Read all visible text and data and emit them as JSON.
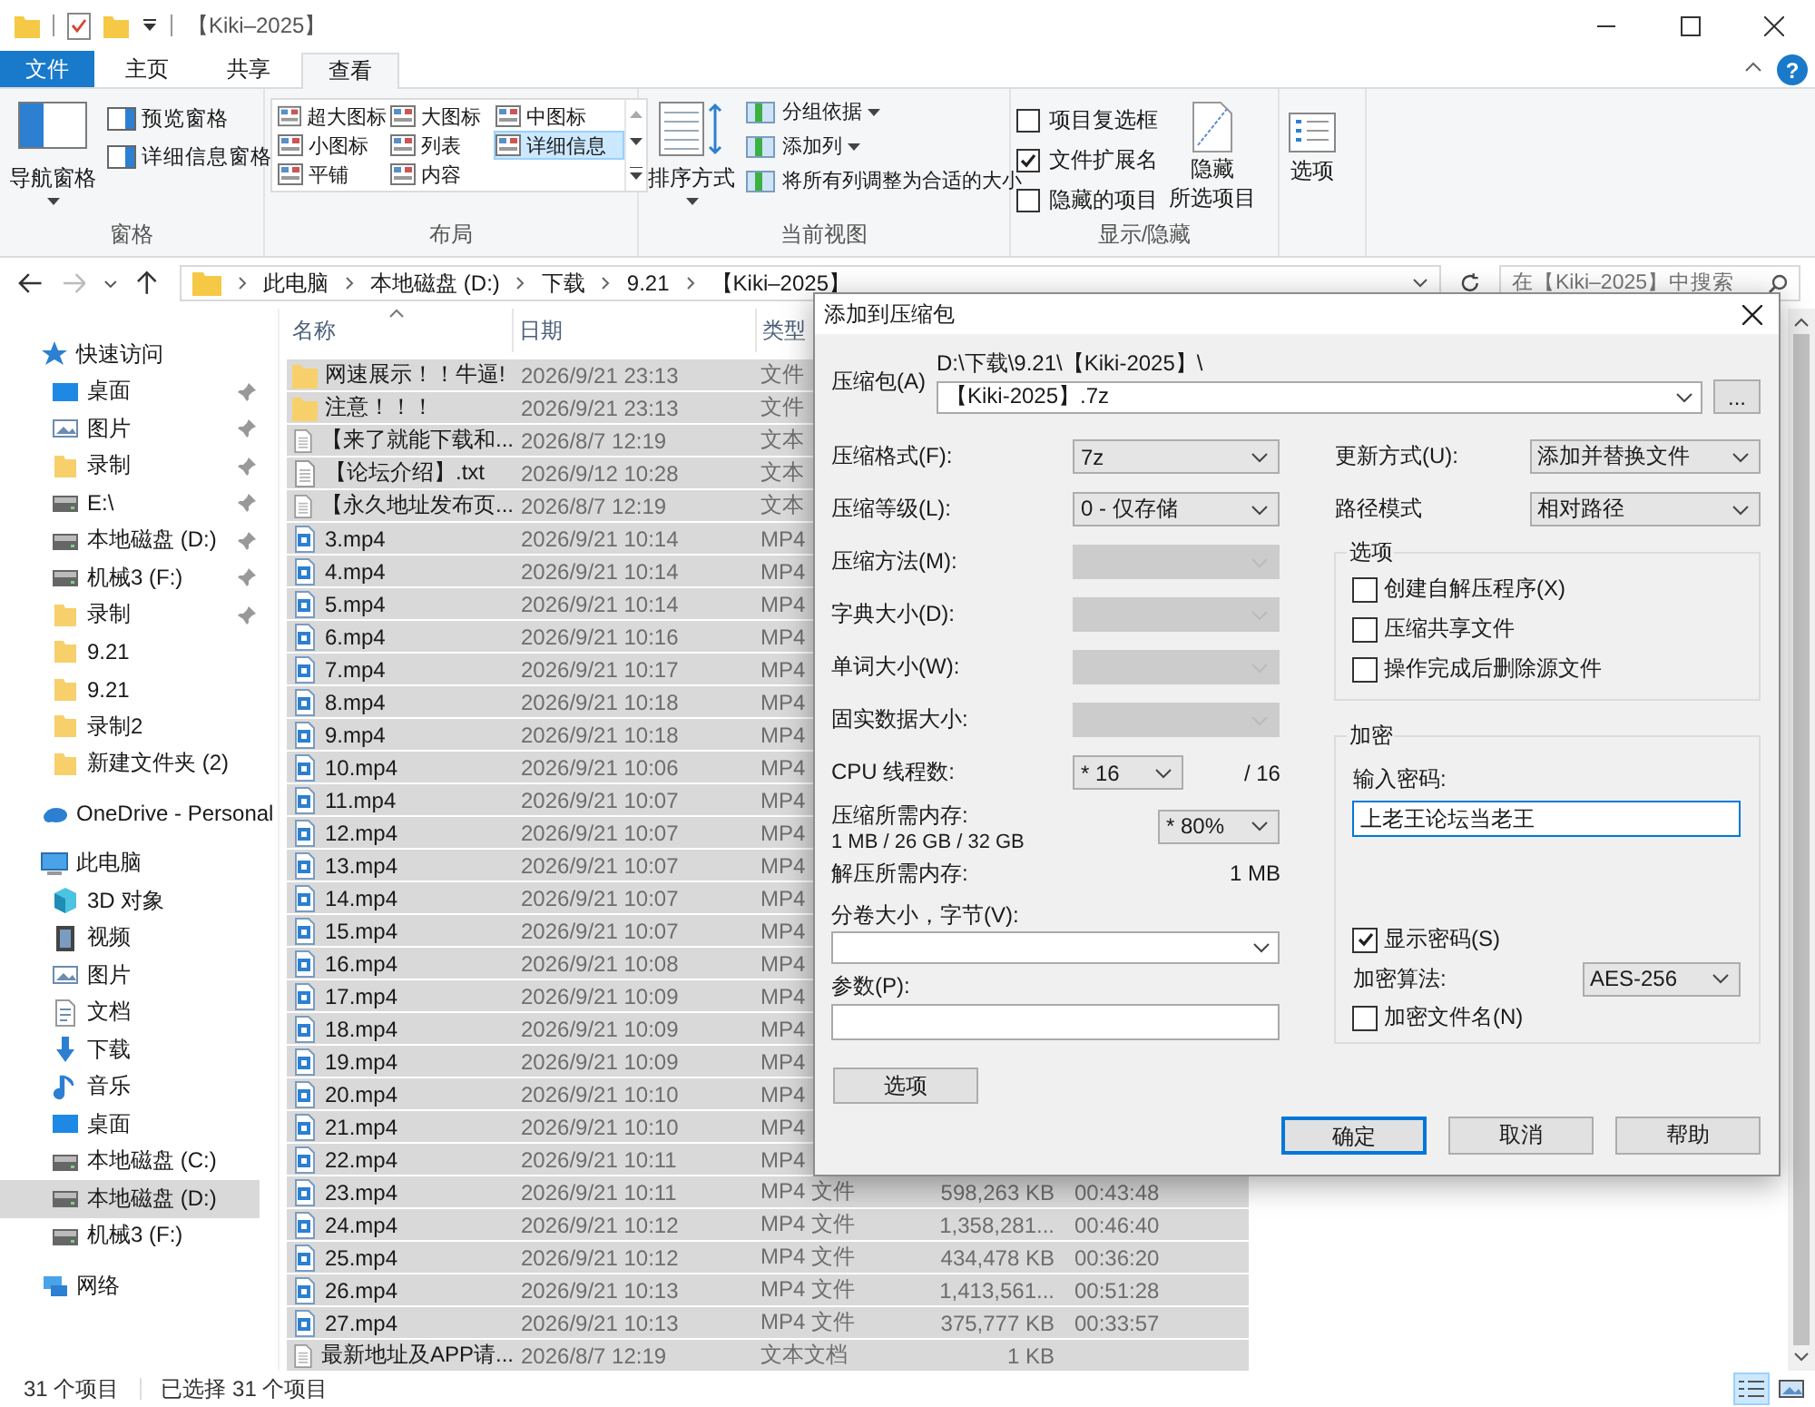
{
  "window": {
    "title": "【Kiki–2025】"
  },
  "ribbon_tabs": [
    {
      "label": "文件",
      "kind": "file",
      "selected": false
    },
    {
      "label": "主页",
      "kind": "tab",
      "selected": false
    },
    {
      "label": "共享",
      "kind": "tab",
      "selected": false
    },
    {
      "label": "查看",
      "kind": "tab",
      "selected": true
    }
  ],
  "help": "?",
  "ribbon": {
    "panes": {
      "title": "窗格",
      "nav": "导航窗格",
      "items": [
        "预览窗格",
        "详细信息窗格"
      ]
    },
    "layout": {
      "title": "布局",
      "items": [
        {
          "label": "超大图标",
          "selected": false
        },
        {
          "label": "大图标",
          "selected": false
        },
        {
          "label": "中图标",
          "selected": false
        },
        {
          "label": "小图标",
          "selected": false
        },
        {
          "label": "列表",
          "selected": false
        },
        {
          "label": "详细信息",
          "selected": true
        },
        {
          "label": "平铺",
          "selected": false
        },
        {
          "label": "内容",
          "selected": false
        }
      ]
    },
    "current_view": {
      "title": "当前视图",
      "sort": "排序方式",
      "items": [
        {
          "label": "分组依据",
          "dropdown": true
        },
        {
          "label": "添加列",
          "dropdown": true
        },
        {
          "label": "将所有列调整为合适的大小",
          "dropdown": false
        }
      ]
    },
    "show_hide": {
      "title": "显示/隐藏",
      "checks": [
        {
          "label": "项目复选框",
          "checked": false
        },
        {
          "label": "文件扩展名",
          "checked": true
        },
        {
          "label": "隐藏的项目",
          "checked": false
        }
      ],
      "hide_selected": [
        "隐藏",
        "所选项目"
      ]
    },
    "options": "选项"
  },
  "address": {
    "crumbs": [
      "此电脑",
      "本地磁盘 (D:)",
      "下载",
      "9.21",
      "【Kiki–2025】"
    ],
    "search_placeholder": "在【Kiki–2025】中搜索"
  },
  "sidebar": [
    {
      "label": "快速访问",
      "kind": "star",
      "selected": false,
      "children": [
        {
          "label": "桌面",
          "kind": "desktop",
          "pinned": true,
          "selected": false
        },
        {
          "label": "图片",
          "kind": "pictures",
          "pinned": true,
          "selected": false
        },
        {
          "label": "录制",
          "kind": "folder",
          "pinned": true,
          "selected": false
        },
        {
          "label": "E:\\",
          "kind": "drive",
          "pinned": true,
          "selected": false
        },
        {
          "label": "本地磁盘 (D:)",
          "kind": "drive",
          "pinned": true,
          "selected": false
        },
        {
          "label": "机械3 (F:)",
          "kind": "drive",
          "pinned": true,
          "selected": false
        },
        {
          "label": "录制",
          "kind": "folder",
          "pinned": true,
          "selected": false
        },
        {
          "label": "9.21",
          "kind": "folder",
          "pinned": false,
          "selected": false
        },
        {
          "label": "9.21",
          "kind": "folder",
          "pinned": false,
          "selected": false
        },
        {
          "label": "录制2",
          "kind": "folder",
          "pinned": false,
          "selected": false
        },
        {
          "label": "新建文件夹 (2)",
          "kind": "folder",
          "pinned": false,
          "selected": false
        }
      ]
    },
    {
      "label": "OneDrive - Personal",
      "kind": "cloud",
      "selected": false
    },
    {
      "label": "此电脑",
      "kind": "pc",
      "selected": false,
      "children": [
        {
          "label": "3D 对象",
          "kind": "cube",
          "pinned": false,
          "selected": false
        },
        {
          "label": "视频",
          "kind": "video",
          "pinned": false,
          "selected": false
        },
        {
          "label": "图片",
          "kind": "pictures",
          "pinned": false,
          "selected": false
        },
        {
          "label": "文档",
          "kind": "document",
          "pinned": false,
          "selected": false
        },
        {
          "label": "下载",
          "kind": "download",
          "pinned": false,
          "selected": false
        },
        {
          "label": "音乐",
          "kind": "music",
          "pinned": false,
          "selected": false
        },
        {
          "label": "桌面",
          "kind": "desktop",
          "pinned": false,
          "selected": false
        },
        {
          "label": "本地磁盘 (C:)",
          "kind": "drive",
          "pinned": false,
          "selected": false
        },
        {
          "label": "本地磁盘 (D:)",
          "kind": "drive",
          "pinned": false,
          "selected": true
        },
        {
          "label": "机械3 (F:)",
          "kind": "drive",
          "pinned": false,
          "selected": false
        }
      ]
    },
    {
      "label": "网络",
      "kind": "network",
      "selected": false
    }
  ],
  "file_list": {
    "columns": [
      "名称",
      "日期",
      "类型"
    ],
    "rows": [
      {
        "name": "网速展示！！牛逼!",
        "kind": "folder",
        "date": "2026/9/21 23:13",
        "type": "文件",
        "selected": true
      },
      {
        "name": "注意！！！",
        "kind": "folder",
        "date": "2026/9/21 23:13",
        "type": "文件",
        "selected": true
      },
      {
        "name": "【来了就能下载和...",
        "kind": "text",
        "date": "2026/8/7 12:19",
        "type": "文本",
        "selected": true
      },
      {
        "name": "【论坛介绍】.txt",
        "kind": "text",
        "date": "2026/9/12 10:28",
        "type": "文本",
        "selected": true
      },
      {
        "name": "【永久地址发布页...",
        "kind": "text",
        "date": "2026/8/7 12:19",
        "type": "文本",
        "selected": true
      },
      {
        "name": "3.mp4",
        "kind": "video",
        "date": "2026/9/21 10:14",
        "type": "MP4",
        "selected": true
      },
      {
        "name": "4.mp4",
        "kind": "video",
        "date": "2026/9/21 10:14",
        "type": "MP4",
        "selected": true
      },
      {
        "name": "5.mp4",
        "kind": "video",
        "date": "2026/9/21 10:14",
        "type": "MP4",
        "selected": true
      },
      {
        "name": "6.mp4",
        "kind": "video",
        "date": "2026/9/21 10:16",
        "type": "MP4",
        "selected": true
      },
      {
        "name": "7.mp4",
        "kind": "video",
        "date": "2026/9/21 10:17",
        "type": "MP4",
        "selected": true
      },
      {
        "name": "8.mp4",
        "kind": "video",
        "date": "2026/9/21 10:18",
        "type": "MP4",
        "selected": true
      },
      {
        "name": "9.mp4",
        "kind": "video",
        "date": "2026/9/21 10:18",
        "type": "MP4",
        "selected": true
      },
      {
        "name": "10.mp4",
        "kind": "video",
        "date": "2026/9/21 10:06",
        "type": "MP4",
        "selected": true
      },
      {
        "name": "11.mp4",
        "kind": "video",
        "date": "2026/9/21 10:07",
        "type": "MP4",
        "selected": true
      },
      {
        "name": "12.mp4",
        "kind": "video",
        "date": "2026/9/21 10:07",
        "type": "MP4",
        "selected": true
      },
      {
        "name": "13.mp4",
        "kind": "video",
        "date": "2026/9/21 10:07",
        "type": "MP4",
        "selected": true
      },
      {
        "name": "14.mp4",
        "kind": "video",
        "date": "2026/9/21 10:07",
        "type": "MP4",
        "selected": true
      },
      {
        "name": "15.mp4",
        "kind": "video",
        "date": "2026/9/21 10:07",
        "type": "MP4",
        "selected": true
      },
      {
        "name": "16.mp4",
        "kind": "video",
        "date": "2026/9/21 10:08",
        "type": "MP4",
        "selected": true
      },
      {
        "name": "17.mp4",
        "kind": "video",
        "date": "2026/9/21 10:09",
        "type": "MP4",
        "selected": true
      },
      {
        "name": "18.mp4",
        "kind": "video",
        "date": "2026/9/21 10:09",
        "type": "MP4",
        "selected": true
      },
      {
        "name": "19.mp4",
        "kind": "video",
        "date": "2026/9/21 10:09",
        "type": "MP4",
        "selected": true
      },
      {
        "name": "20.mp4",
        "kind": "video",
        "date": "2026/9/21 10:10",
        "type": "MP4",
        "selected": true
      },
      {
        "name": "21.mp4",
        "kind": "video",
        "date": "2026/9/21 10:10",
        "type": "MP4",
        "selected": true
      },
      {
        "name": "22.mp4",
        "kind": "video",
        "date": "2026/9/21 10:11",
        "type": "MP4",
        "selected": true
      },
      {
        "name": "23.mp4",
        "kind": "video",
        "date": "2026/9/21 10:11",
        "type": "MP4 文件",
        "size": "598,263 KB",
        "duration": "00:43:48",
        "selected": true
      },
      {
        "name": "24.mp4",
        "kind": "video",
        "date": "2026/9/21 10:12",
        "type": "MP4 文件",
        "size": "1,358,281...",
        "duration": "00:46:40",
        "selected": true
      },
      {
        "name": "25.mp4",
        "kind": "video",
        "date": "2026/9/21 10:12",
        "type": "MP4 文件",
        "size": "434,478 KB",
        "duration": "00:36:20",
        "selected": true
      },
      {
        "name": "26.mp4",
        "kind": "video",
        "date": "2026/9/21 10:13",
        "type": "MP4 文件",
        "size": "1,413,561...",
        "duration": "00:51:28",
        "selected": true
      },
      {
        "name": "27.mp4",
        "kind": "video",
        "date": "2026/9/21 10:13",
        "type": "MP4 文件",
        "size": "375,777 KB",
        "duration": "00:33:57",
        "selected": true
      },
      {
        "name": "最新地址及APP请...",
        "kind": "text",
        "date": "2026/8/7 12:19",
        "type": "文本文档",
        "size": "1 KB",
        "selected": true
      }
    ]
  },
  "status_bar": {
    "count": "31 个项目",
    "selection": "已选择 31 个项目",
    "view_buttons": [
      {
        "kind": "details",
        "selected": true
      },
      {
        "kind": "thumbnails",
        "selected": false
      }
    ]
  },
  "dialog": {
    "title": "添加到压缩包",
    "archive_label": "压缩包(A)",
    "archive_dir": "D:\\下载\\9.21\\【Kiki-2025】\\",
    "archive_name": "【Kiki-2025】.7z",
    "browse": "...",
    "fields": [
      {
        "label": "压缩格式(F):",
        "value": "7z",
        "disabled": false
      },
      {
        "label": "压缩等级(L):",
        "value": "0 - 仅存储",
        "disabled": false
      },
      {
        "label": "压缩方法(M):",
        "disabled": true
      },
      {
        "label": "字典大小(D):",
        "disabled": true
      },
      {
        "label": "单词大小(W):",
        "disabled": true
      },
      {
        "label": "固实数据大小:",
        "disabled": true
      }
    ],
    "threads": {
      "label": "CPU 线程数:",
      "value": "* 16",
      "max": "/ 16"
    },
    "memory": {
      "label": "压缩所需内存:",
      "detail": "1 MB / 26 GB / 32 GB",
      "value": "* 80%"
    },
    "decompress_memory": {
      "label": "解压所需内存:",
      "value": "1 MB"
    },
    "volume": {
      "label": "分卷大小，字节(V):"
    },
    "params": {
      "label": "参数(P):"
    },
    "options_button": "选项",
    "update_mode": {
      "label": "更新方式(U):",
      "value": "添加并替换文件"
    },
    "path_mode": {
      "label": "路径模式",
      "value": "相对路径"
    },
    "options_group": {
      "title": "选项",
      "checks": [
        {
          "label": "创建自解压程序(X)",
          "checked": false
        },
        {
          "label": "压缩共享文件",
          "checked": false
        },
        {
          "label": "操作完成后删除源文件",
          "checked": false
        }
      ]
    },
    "encryption": {
      "title": "加密",
      "password_label": "输入密码:",
      "password": "上老王论坛当老王",
      "show_password": {
        "label": "显示密码(S)",
        "checked": true
      },
      "method_label": "加密算法:",
      "method": "AES-256",
      "encrypt_names": {
        "label": "加密文件名(N)",
        "checked": false
      }
    },
    "buttons": [
      {
        "label": "确定",
        "default": true
      },
      {
        "label": "取消",
        "default": false
      },
      {
        "label": "帮助",
        "default": false
      }
    ]
  }
}
